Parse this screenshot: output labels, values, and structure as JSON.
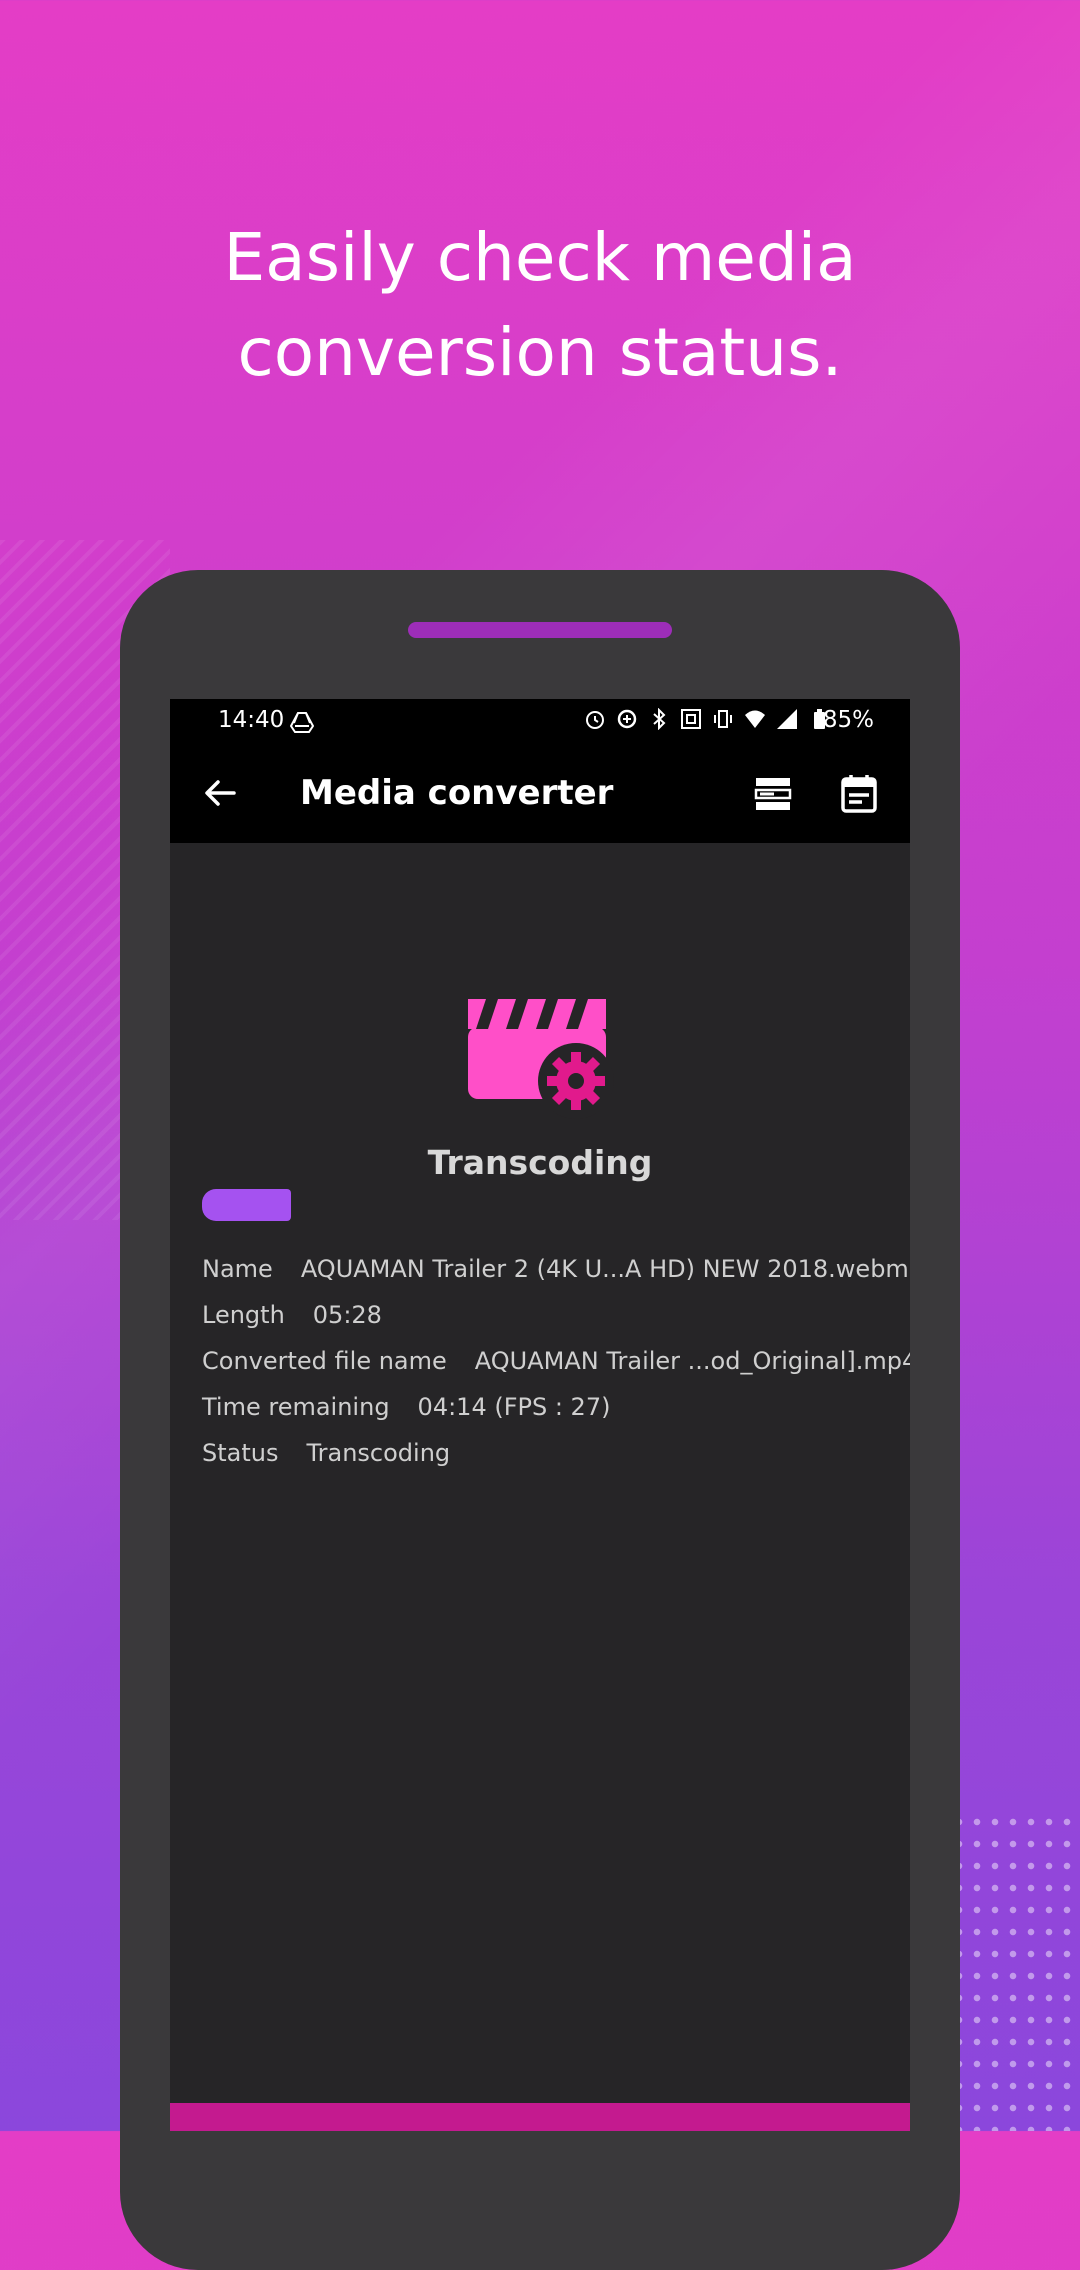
{
  "promo": {
    "headline_line1": "Easily check media",
    "headline_line2": "conversion status."
  },
  "statusbar": {
    "time": "14:40",
    "battery": "85%",
    "icons": [
      "drive-icon",
      "alarm-icon",
      "data-saver-icon",
      "bluetooth-icon",
      "nfc-icon",
      "vibrate-icon",
      "wifi-icon",
      "signal-icon",
      "battery-icon"
    ]
  },
  "appbar": {
    "title": "Media converter"
  },
  "conversion": {
    "status_title": "Transcoding",
    "progress_fraction": 0.12,
    "details": [
      {
        "label": "Name",
        "value": "AQUAMAN Trailer 2 (4K U...A HD) NEW 2018.webm"
      },
      {
        "label": "Length",
        "value": "05:28"
      },
      {
        "label": "Converted file name",
        "value": "AQUAMAN Trailer ...od_Original].mp4"
      },
      {
        "label": "Time remaining",
        "value": "04:14 (FPS : 27)"
      },
      {
        "label": "Status",
        "value": "Transcoding"
      }
    ]
  },
  "colors": {
    "accent": "#ff4fc8",
    "progress": "#a552f0",
    "bottom_bar": "#c41a8f"
  }
}
